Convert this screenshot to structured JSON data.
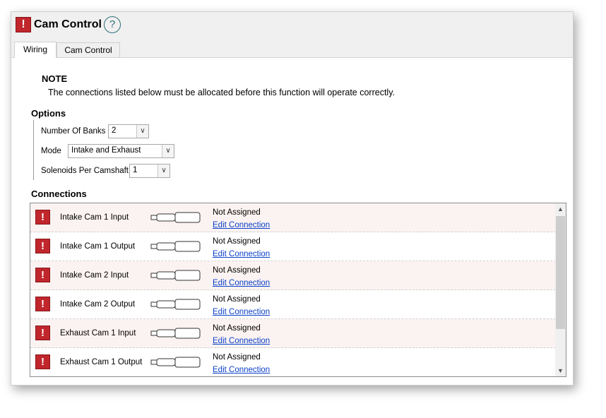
{
  "window": {
    "title": "Cam Control",
    "help_label": "?",
    "warning_icon": "warning-square-icon"
  },
  "tabs": [
    {
      "label": "Wiring",
      "active": true
    },
    {
      "label": "Cam Control",
      "active": false
    }
  ],
  "note": {
    "title": "NOTE",
    "text": "The connections listed below must be allocated before this function will operate correctly."
  },
  "options": {
    "title": "Options",
    "number_of_banks": {
      "label": "Number Of Banks",
      "value": "2"
    },
    "mode": {
      "label": "Mode",
      "value": "Intake and Exhaust"
    },
    "solenoids_per_camshaft": {
      "label": "Solenoids Per Camshaft",
      "value": "1"
    }
  },
  "connections": {
    "title": "Connections",
    "rows": [
      {
        "name": "Intake Cam 1 Input",
        "status": "Not Assigned",
        "link": "Edit Connection"
      },
      {
        "name": "Intake Cam 1 Output",
        "status": "Not Assigned",
        "link": "Edit Connection"
      },
      {
        "name": "Intake Cam 2 Input",
        "status": "Not Assigned",
        "link": "Edit Connection"
      },
      {
        "name": "Intake Cam 2 Output",
        "status": "Not Assigned",
        "link": "Edit Connection"
      },
      {
        "name": "Exhaust Cam 1 Input",
        "status": "Not Assigned",
        "link": "Edit Connection"
      },
      {
        "name": "Exhaust Cam 1 Output",
        "status": "Not Assigned",
        "link": "Edit Connection"
      }
    ]
  },
  "colors": {
    "warning_red": "#c0262c",
    "link_blue": "#0b40c8",
    "row_tint": "#fbf3f2"
  }
}
